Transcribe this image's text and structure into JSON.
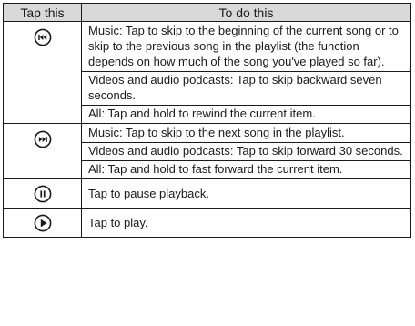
{
  "table": {
    "headers": [
      "Tap this",
      "To do this"
    ],
    "rows": [
      {
        "icon": "previous-rewind-icon",
        "descriptions": [
          "Music: Tap to skip to the beginning of the current song or to skip to the previous song in the playlist (the function depends on how much of the song you've played so far).",
          "Videos and audio podcasts: Tap to skip backward seven seconds.",
          "All: Tap and hold to rewind the current item."
        ]
      },
      {
        "icon": "next-fast-forward-icon",
        "descriptions": [
          "Music: Tap to skip to the next song in the playlist.",
          "Videos and audio podcasts: Tap to skip forward 30 seconds.",
          "All: Tap and hold to fast forward the current item."
        ]
      },
      {
        "icon": "pause-icon",
        "descriptions": [
          "Tap to pause playback."
        ]
      },
      {
        "icon": "play-icon",
        "descriptions": [
          "Tap to play."
        ]
      }
    ]
  }
}
